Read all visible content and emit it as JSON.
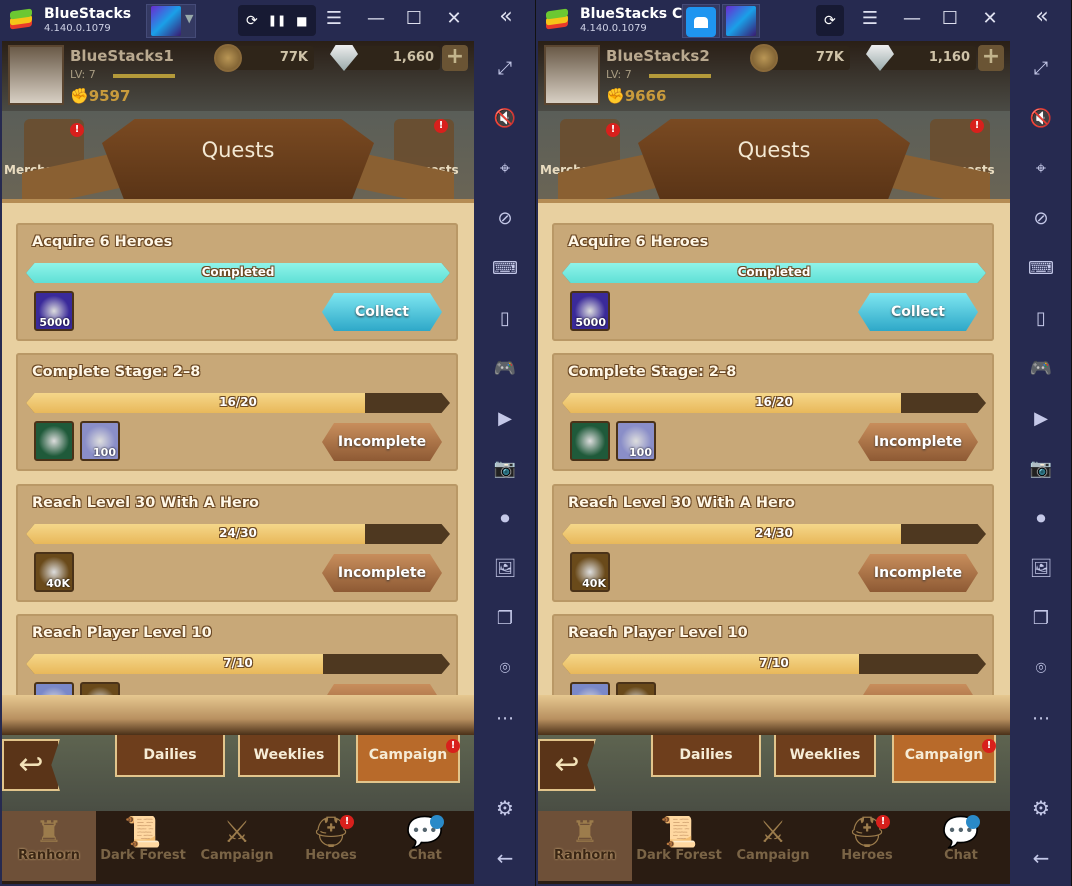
{
  "windows": [
    {
      "app_name": "BlueStacks",
      "version": "4.140.0.1079",
      "has_home_tab": false,
      "controls": [
        "⟳",
        "❚❚",
        "■"
      ],
      "player": {
        "name": "BlueStacks1",
        "level_label": "LV:",
        "level": "7",
        "power": "9597"
      },
      "gold": "77K",
      "diamonds": "1,660"
    },
    {
      "app_name": "BlueStacks Cl...",
      "version": "4.140.0.1079",
      "has_home_tab": true,
      "controls": [
        "⟳"
      ],
      "player": {
        "name": "BlueStacks2",
        "level_label": "LV:",
        "level": "7",
        "power": "9666"
      },
      "gold": "77K",
      "diamonds": "1,160"
    }
  ],
  "side_labels": {
    "left": "Mercha",
    "right": "uests"
  },
  "quests_title": "Quests",
  "quests": [
    {
      "title": "Acquire 6 Heroes",
      "progress_text": "Completed",
      "progress": 1.0,
      "completed": true,
      "rewards": [
        {
          "icon": "blue-orb-icon",
          "label": "5000",
          "color": "#3a2a9a"
        }
      ],
      "button": "Collect"
    },
    {
      "title": "Complete Stage: 2–8",
      "progress_text": "16/20",
      "progress": 0.8,
      "completed": false,
      "rewards": [
        {
          "icon": "armor-icon",
          "label": "",
          "color": "#1f5a3a"
        },
        {
          "icon": "diamond-icon",
          "label": "100",
          "color": "#8a8ec8"
        }
      ],
      "button": "Incomplete"
    },
    {
      "title": "Reach Level 30 With A Hero",
      "progress_text": "24/30",
      "progress": 0.8,
      "completed": false,
      "rewards": [
        {
          "icon": "gold-coin-icon",
          "label": "40K",
          "color": "#6a4a1a"
        }
      ],
      "button": "Incomplete"
    },
    {
      "title": "Reach Player Level 10",
      "progress_text": "7/10",
      "progress": 0.7,
      "completed": false,
      "rewards": [
        {
          "icon": "diamond-icon",
          "label": "",
          "color": "#7a88c8"
        },
        {
          "icon": "gold-coin-icon",
          "label": "",
          "color": "#6a4a1a"
        }
      ],
      "button": ""
    }
  ],
  "tabs": [
    {
      "label": "Dailies",
      "active": false
    },
    {
      "label": "Weeklies",
      "active": false
    },
    {
      "label": "Campaign",
      "active": true,
      "badge": "!"
    }
  ],
  "nav": [
    {
      "label": "Ranhorn",
      "icon": "castle-icon",
      "glyph": "♜",
      "active": true
    },
    {
      "label": "Dark Forest",
      "icon": "scroll-map-icon",
      "glyph": "📜",
      "active": false
    },
    {
      "label": "Campaign",
      "icon": "crest-icon",
      "glyph": "⚔",
      "active": false
    },
    {
      "label": "Heroes",
      "icon": "helmet-icon",
      "glyph": "⛑",
      "active": false,
      "badge": "!"
    },
    {
      "label": "Chat",
      "icon": "chat-bubble-icon",
      "glyph": "💬",
      "active": false
    }
  ],
  "sidebar": [
    {
      "icon": "fullscreen-icon",
      "glyph": "⤢"
    },
    {
      "icon": "volume-mute-icon",
      "glyph": "🔇"
    },
    {
      "icon": "cursor-lock-icon",
      "glyph": "⌖"
    },
    {
      "icon": "eye-off-icon",
      "glyph": "⊘"
    },
    {
      "icon": "keyboard-icon",
      "glyph": "⌨"
    },
    {
      "icon": "portrait-icon",
      "glyph": "▯"
    },
    {
      "icon": "gamepad-icon",
      "glyph": "🎮"
    },
    {
      "icon": "macro-icon",
      "glyph": "▶"
    },
    {
      "icon": "camera-icon",
      "glyph": "📷"
    },
    {
      "icon": "record-icon",
      "glyph": "⏺"
    },
    {
      "icon": "media-icon",
      "glyph": "🖼"
    },
    {
      "icon": "multi-instance-icon",
      "glyph": "❐"
    },
    {
      "icon": "location-icon",
      "glyph": "⌾"
    },
    {
      "icon": "more-icon",
      "glyph": "⋯"
    }
  ],
  "sidebar_bottom": [
    {
      "icon": "settings-icon",
      "glyph": "⚙"
    },
    {
      "icon": "back-icon",
      "glyph": "←"
    }
  ],
  "collapse_glyph": "«",
  "back_glyph": "↩",
  "plus_glyph": "+",
  "window_buttons": [
    "☰",
    "—",
    "☐",
    "✕"
  ]
}
